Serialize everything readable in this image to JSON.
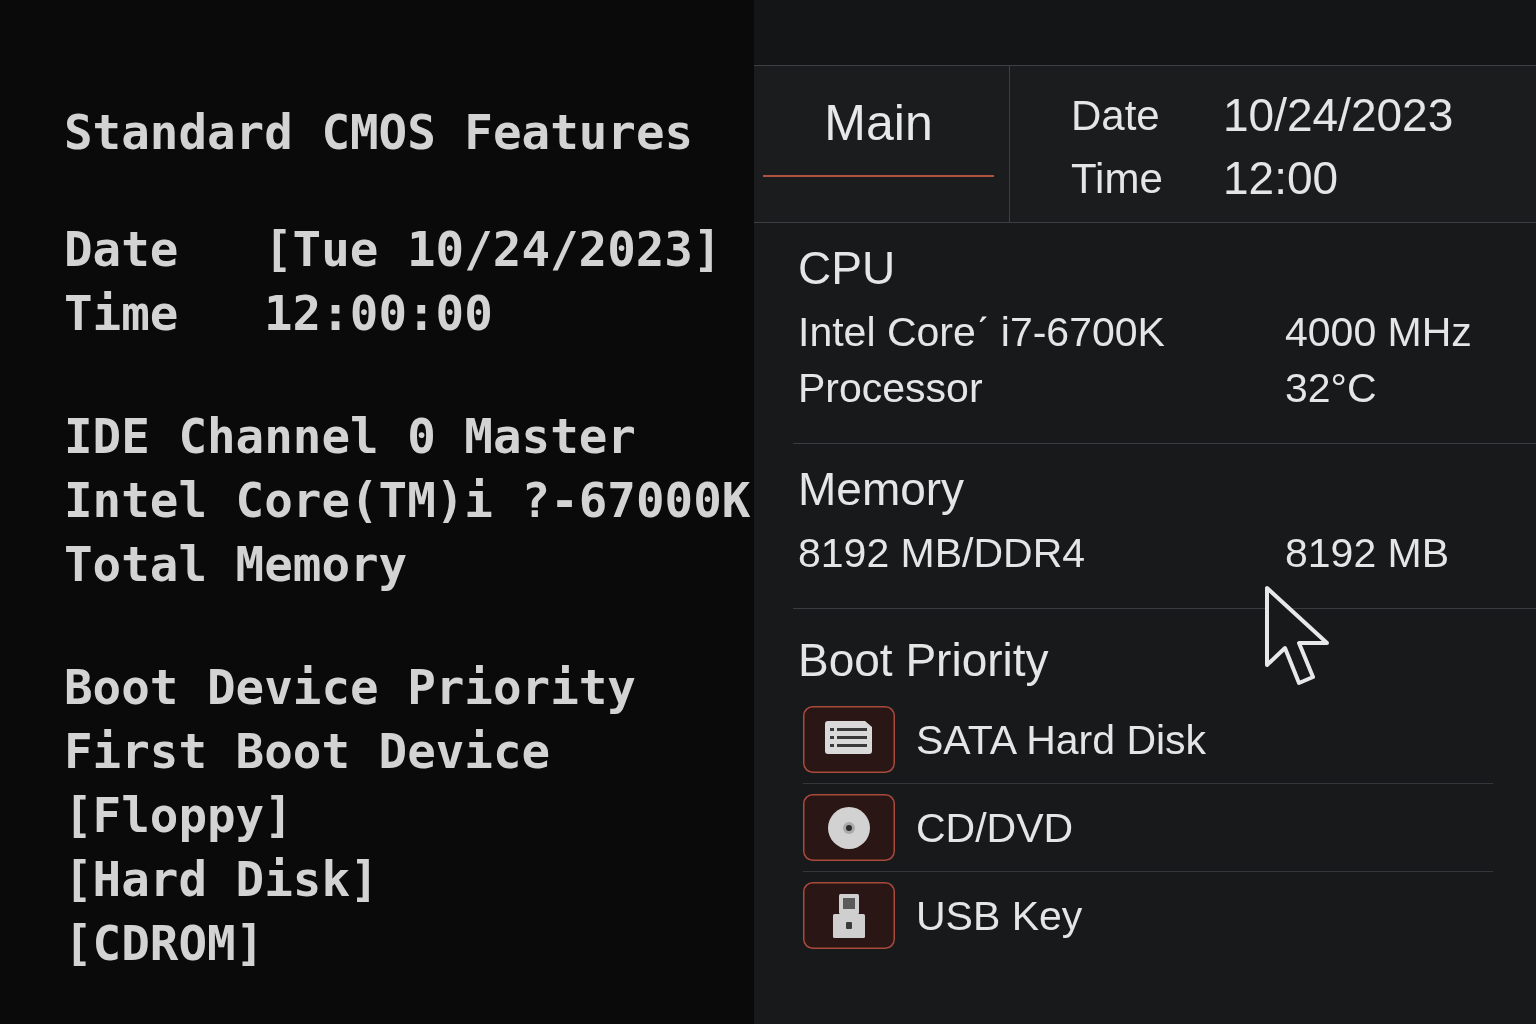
{
  "legacy_bios": {
    "title": "Standard CMOS Features",
    "fields": [
      {
        "label": "Date",
        "value": "[Tue 10/24/2023]"
      },
      {
        "label": "Time",
        "value": "12:00:00"
      }
    ],
    "hardware_lines": [
      "IDE Channel 0 Master",
      "Intel Core(TM)i ?-67000K",
      "Total Memory"
    ],
    "boot": {
      "heading": "Boot Device Priority",
      "label": "First Boot Device",
      "options": [
        "[Floppy]",
        "[Hard Disk]",
        "[CDROM]"
      ]
    }
  },
  "modern_bios": {
    "tabs": [
      {
        "label": "Main",
        "selected": true
      }
    ],
    "header_fields": [
      {
        "label": "Date",
        "value": "10/24/2023"
      },
      {
        "label": "Time",
        "value": "12:00"
      }
    ],
    "sections": [
      {
        "title": "CPU",
        "rows": [
          {
            "label": "Intel Coreˊ i7-6700K",
            "value": "4000 MHz"
          },
          {
            "label": "Processor",
            "value": "32°C"
          }
        ]
      },
      {
        "title": "Memory",
        "rows": [
          {
            "label": "8192 MB/DDR4",
            "value": "8192 MB"
          }
        ]
      }
    ],
    "boot_priority": {
      "title": "Boot Priority",
      "devices": [
        {
          "kind": "hard-disk",
          "label": "SATA Hard Disk"
        },
        {
          "kind": "optical",
          "label": "CD/DVD"
        },
        {
          "kind": "usb",
          "label": "USB Key"
        }
      ]
    }
  }
}
